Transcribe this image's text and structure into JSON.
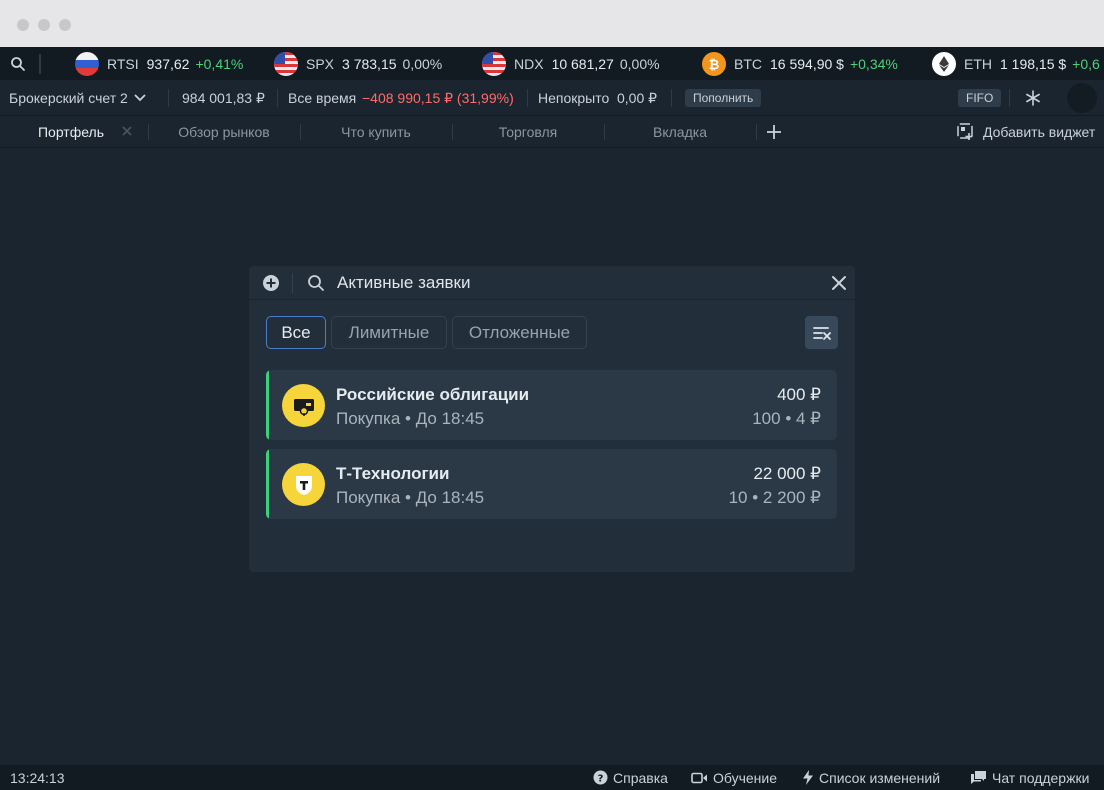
{
  "ticker": [
    {
      "symbol": "RTSI",
      "price": "937,62",
      "change": "+0,41%",
      "trend": "up",
      "icon": "russia-flag-icon"
    },
    {
      "symbol": "SPX",
      "price": "3 783,15",
      "change": "0,00%",
      "trend": "flat",
      "icon": "usa-flag-icon"
    },
    {
      "symbol": "NDX",
      "price": "10 681,27",
      "change": "0,00%",
      "trend": "flat",
      "icon": "usa-flag-icon"
    },
    {
      "symbol": "BTC",
      "price": "16 594,90 $",
      "change": "+0,34%",
      "trend": "up",
      "icon": "bitcoin-icon"
    },
    {
      "symbol": "ETH",
      "price": "1 198,15 $",
      "change": "+0,6",
      "trend": "up",
      "icon": "ethereum-icon"
    }
  ],
  "account": {
    "name": "Брокерский счет 2",
    "balance": "984 001,83 ₽",
    "period_label": "Все время",
    "period_pnl": "−408 990,15 ₽ (31,99%)",
    "uncovered_label": "Непокрыто",
    "uncovered_value": "0,00 ₽",
    "topup_label": "Пополнить",
    "fifo_label": "FIFO"
  },
  "tabs": [
    {
      "label": "Портфель",
      "active": true
    },
    {
      "label": "Обзор рынков",
      "active": false
    },
    {
      "label": "Что купить",
      "active": false
    },
    {
      "label": "Торговля",
      "active": false
    },
    {
      "label": "Вкладка",
      "active": false
    }
  ],
  "add_widget_label": "Добавить виджет",
  "widget": {
    "title": "Активные заявки",
    "filters": [
      {
        "label": "Все",
        "active": true
      },
      {
        "label": "Лимитные",
        "active": false
      },
      {
        "label": "Отложенные",
        "active": false
      }
    ],
    "orders": [
      {
        "name": "Российские облигации",
        "side": "Покупка",
        "until": "До 18:45",
        "amount": "400 ₽",
        "qty": "100",
        "price": "4 ₽",
        "logo": "bonds-logo-icon"
      },
      {
        "name": "Т-Технологии",
        "side": "Покупка",
        "until": "До 18:45",
        "amount": "22 000 ₽",
        "qty": "10",
        "price": "2 200 ₽",
        "logo": "t-shield-logo-icon"
      }
    ]
  },
  "status": {
    "time": "13:24:13",
    "help": "Справка",
    "learning": "Обучение",
    "changelog": "Список изменений",
    "support": "Чат поддержки"
  },
  "colors": {
    "background": "#1b2530",
    "positive": "#4fd17a",
    "negative": "#ff6b6b",
    "accent": "#4c7dc9",
    "order_bar": "#3dd07a",
    "logo_yellow": "#f5d53a"
  }
}
